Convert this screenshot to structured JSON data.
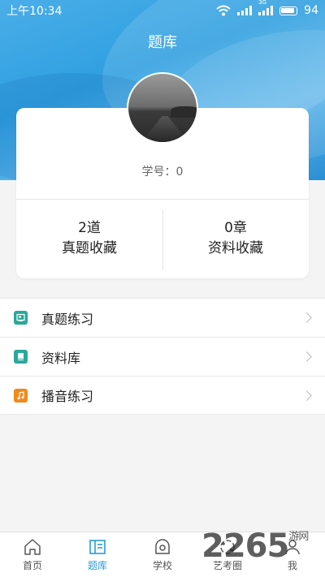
{
  "status": {
    "time": "上午10:34",
    "battery": "94",
    "network": "3G"
  },
  "header": {
    "title": "题库"
  },
  "profile": {
    "student_no": "学号：0"
  },
  "stats": [
    {
      "count": "2道",
      "label": "真题收藏"
    },
    {
      "count": "0章",
      "label": "资料收藏"
    }
  ],
  "menu": [
    {
      "label": "真题练习",
      "icon": "exam-icon",
      "color": "#2aa89a"
    },
    {
      "label": "资料库",
      "icon": "book-icon",
      "color": "#2aa89a"
    },
    {
      "label": "播音练习",
      "icon": "music-icon",
      "color": "#f08a1c"
    }
  ],
  "nav": [
    {
      "label": "首页",
      "icon": "home-icon"
    },
    {
      "label": "题库",
      "icon": "question-bank-icon",
      "active": true
    },
    {
      "label": "学校",
      "icon": "school-icon"
    },
    {
      "label": "艺考圈",
      "icon": "circle-icon"
    },
    {
      "label": "我",
      "icon": "profile-icon"
    }
  ],
  "watermark": {
    "text": "2265",
    "suffix": "游网"
  },
  "colors": {
    "accent": "#2a9bd8",
    "banner": "#3aa6e4"
  }
}
